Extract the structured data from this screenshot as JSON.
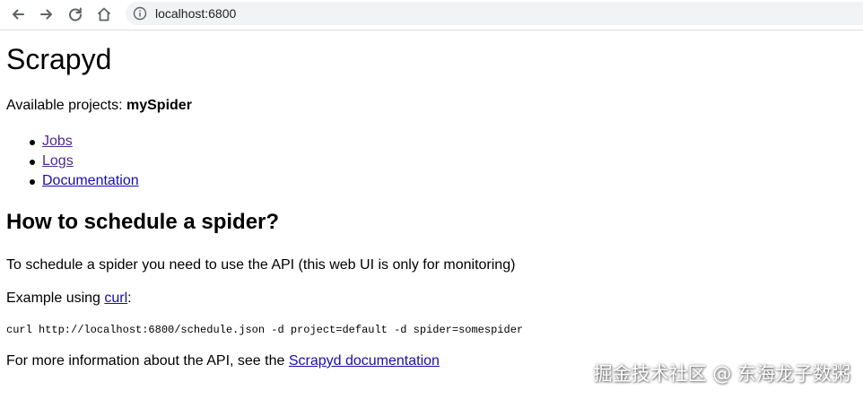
{
  "browser": {
    "url": "localhost:6800",
    "icons": [
      "back-icon",
      "forward-icon",
      "reload-icon",
      "home-icon",
      "info-icon"
    ]
  },
  "page": {
    "title": "Scrapyd",
    "projects_label": "Available projects: ",
    "projects_value": "mySpider",
    "links": [
      "Jobs",
      "Logs",
      "Documentation"
    ],
    "heading": "How to schedule a spider?",
    "schedule_text": "To schedule a spider you need to use the API (this web UI is only for monitoring)",
    "example_prefix": "Example using ",
    "example_link": "curl",
    "example_suffix": ":",
    "curl_command": "curl http://localhost:6800/schedule.json -d project=default -d spider=somespider",
    "more_info_prefix": "For more information about the API, see the ",
    "more_info_link": "Scrapyd documentation"
  },
  "watermark": "掘金技术社区 @ 东海龙子数粥",
  "colors": {
    "link": "#1a0dab",
    "visited_link": "#4b2b8f"
  }
}
